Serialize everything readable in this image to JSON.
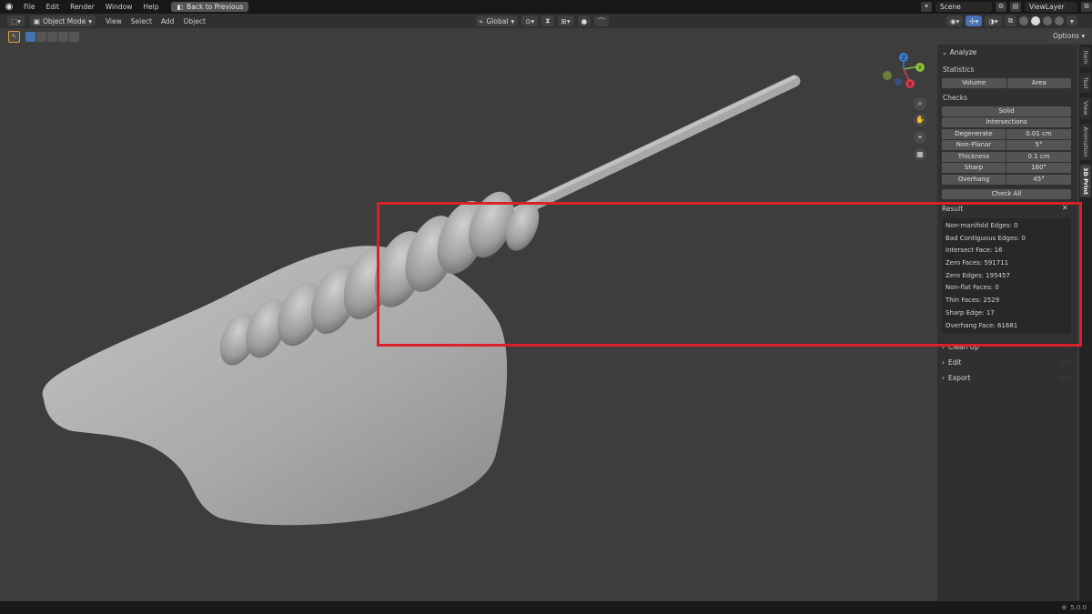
{
  "topbar": {
    "menu": [
      "File",
      "Edit",
      "Render",
      "Window",
      "Help"
    ],
    "back_button": "Back to Previous",
    "scene": "Scene",
    "view_layer": "ViewLayer"
  },
  "header": {
    "mode": "Object Mode",
    "menu": [
      "View",
      "Select",
      "Add",
      "Object"
    ],
    "orientation": "Global",
    "options": "Options"
  },
  "panel": {
    "section": "Analyze",
    "statistics_label": "Statistics",
    "statistics_buttons": [
      "Volume",
      "Area"
    ],
    "checks_label": "Checks",
    "solid_button": "Solid",
    "intersections_button": "Intersections",
    "checks": [
      {
        "name": "Degenerate",
        "value": "0.01 cm"
      },
      {
        "name": "Non-Planar",
        "value": "5°"
      },
      {
        "name": "Thickness",
        "value": "0.1 cm"
      },
      {
        "name": "Sharp",
        "value": "160°"
      },
      {
        "name": "Overhang",
        "value": "45°"
      }
    ],
    "check_all": "Check All",
    "result_label": "Result",
    "results": [
      "Non-manifold Edges: 0",
      "Bad Contiguous Edges: 0",
      "Intersect Face: 16",
      "Zero Faces: 591711",
      "Zero Edges: 195457",
      "Non-flat Faces: 0",
      "Thin Faces: 2529",
      "Sharp Edge: 17",
      "Overhang Face: 61681"
    ],
    "collapsed_sections": [
      "Clean Up",
      "Edit",
      "Export"
    ]
  },
  "tabs": [
    "Item",
    "Tool",
    "View",
    "Animation",
    "3D Print"
  ],
  "gizmo": {
    "x": "X",
    "y": "Y",
    "z": "Z"
  },
  "status": {
    "version": "5.0.0"
  },
  "colors": {
    "highlight": "#d8222a",
    "accent": "#4772b3"
  }
}
